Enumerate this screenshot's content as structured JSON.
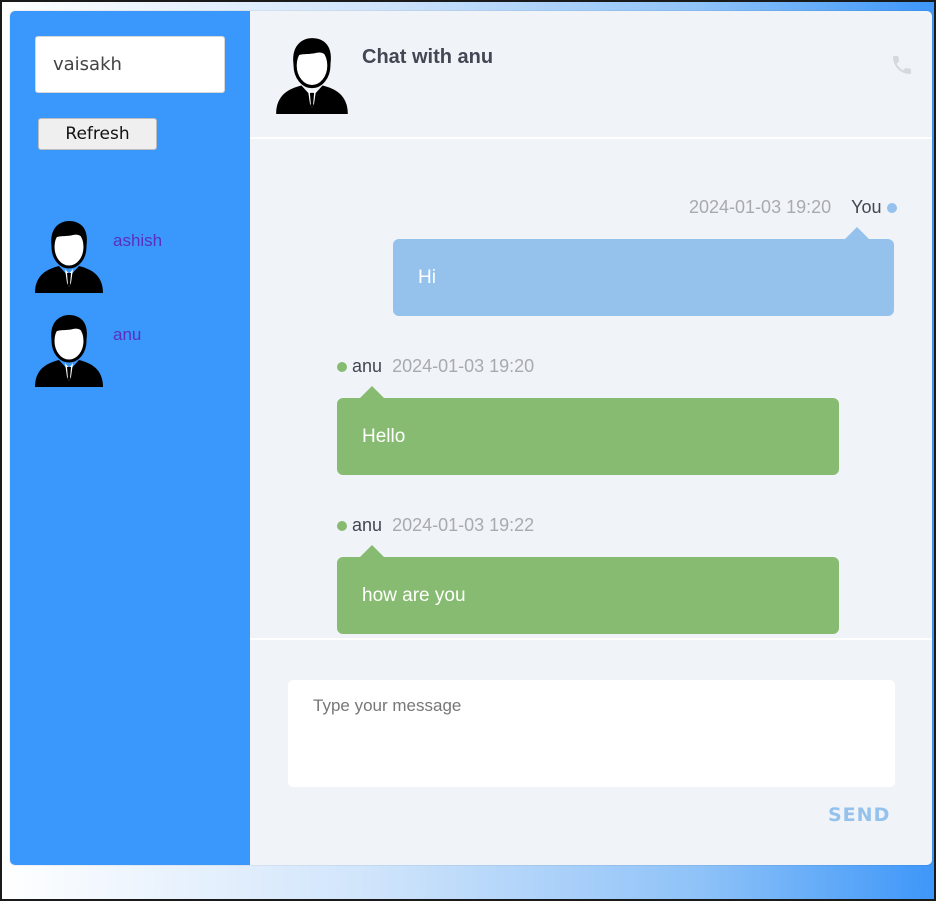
{
  "sidebar": {
    "username_value": "vaisakh",
    "refresh_label": "Refresh",
    "contacts": [
      {
        "name": "ashish",
        "icon": "avatar-icon"
      },
      {
        "name": "anu",
        "icon": "avatar-icon"
      }
    ]
  },
  "header": {
    "title": "Chat with anu",
    "avatar_icon": "avatar-icon",
    "call_icon": "phone-icon"
  },
  "messages": [
    {
      "direction": "sent",
      "sender": "You",
      "time": "2024-01-03 19:20",
      "text": "Hi"
    },
    {
      "direction": "received",
      "sender": "anu",
      "time": "2024-01-03 19:20",
      "text": "Hello"
    },
    {
      "direction": "received",
      "sender": "anu",
      "time": "2024-01-03 19:22",
      "text": "how are you"
    }
  ],
  "composer": {
    "placeholder": "Type your message",
    "send_label": "SEND"
  },
  "colors": {
    "sidebar_bg": "#3a98fd",
    "sent_bubble": "#94c2ed",
    "received_bubble": "#86bb71",
    "contact_name": "#5b2fbd",
    "main_bg": "#f0f3f7"
  }
}
